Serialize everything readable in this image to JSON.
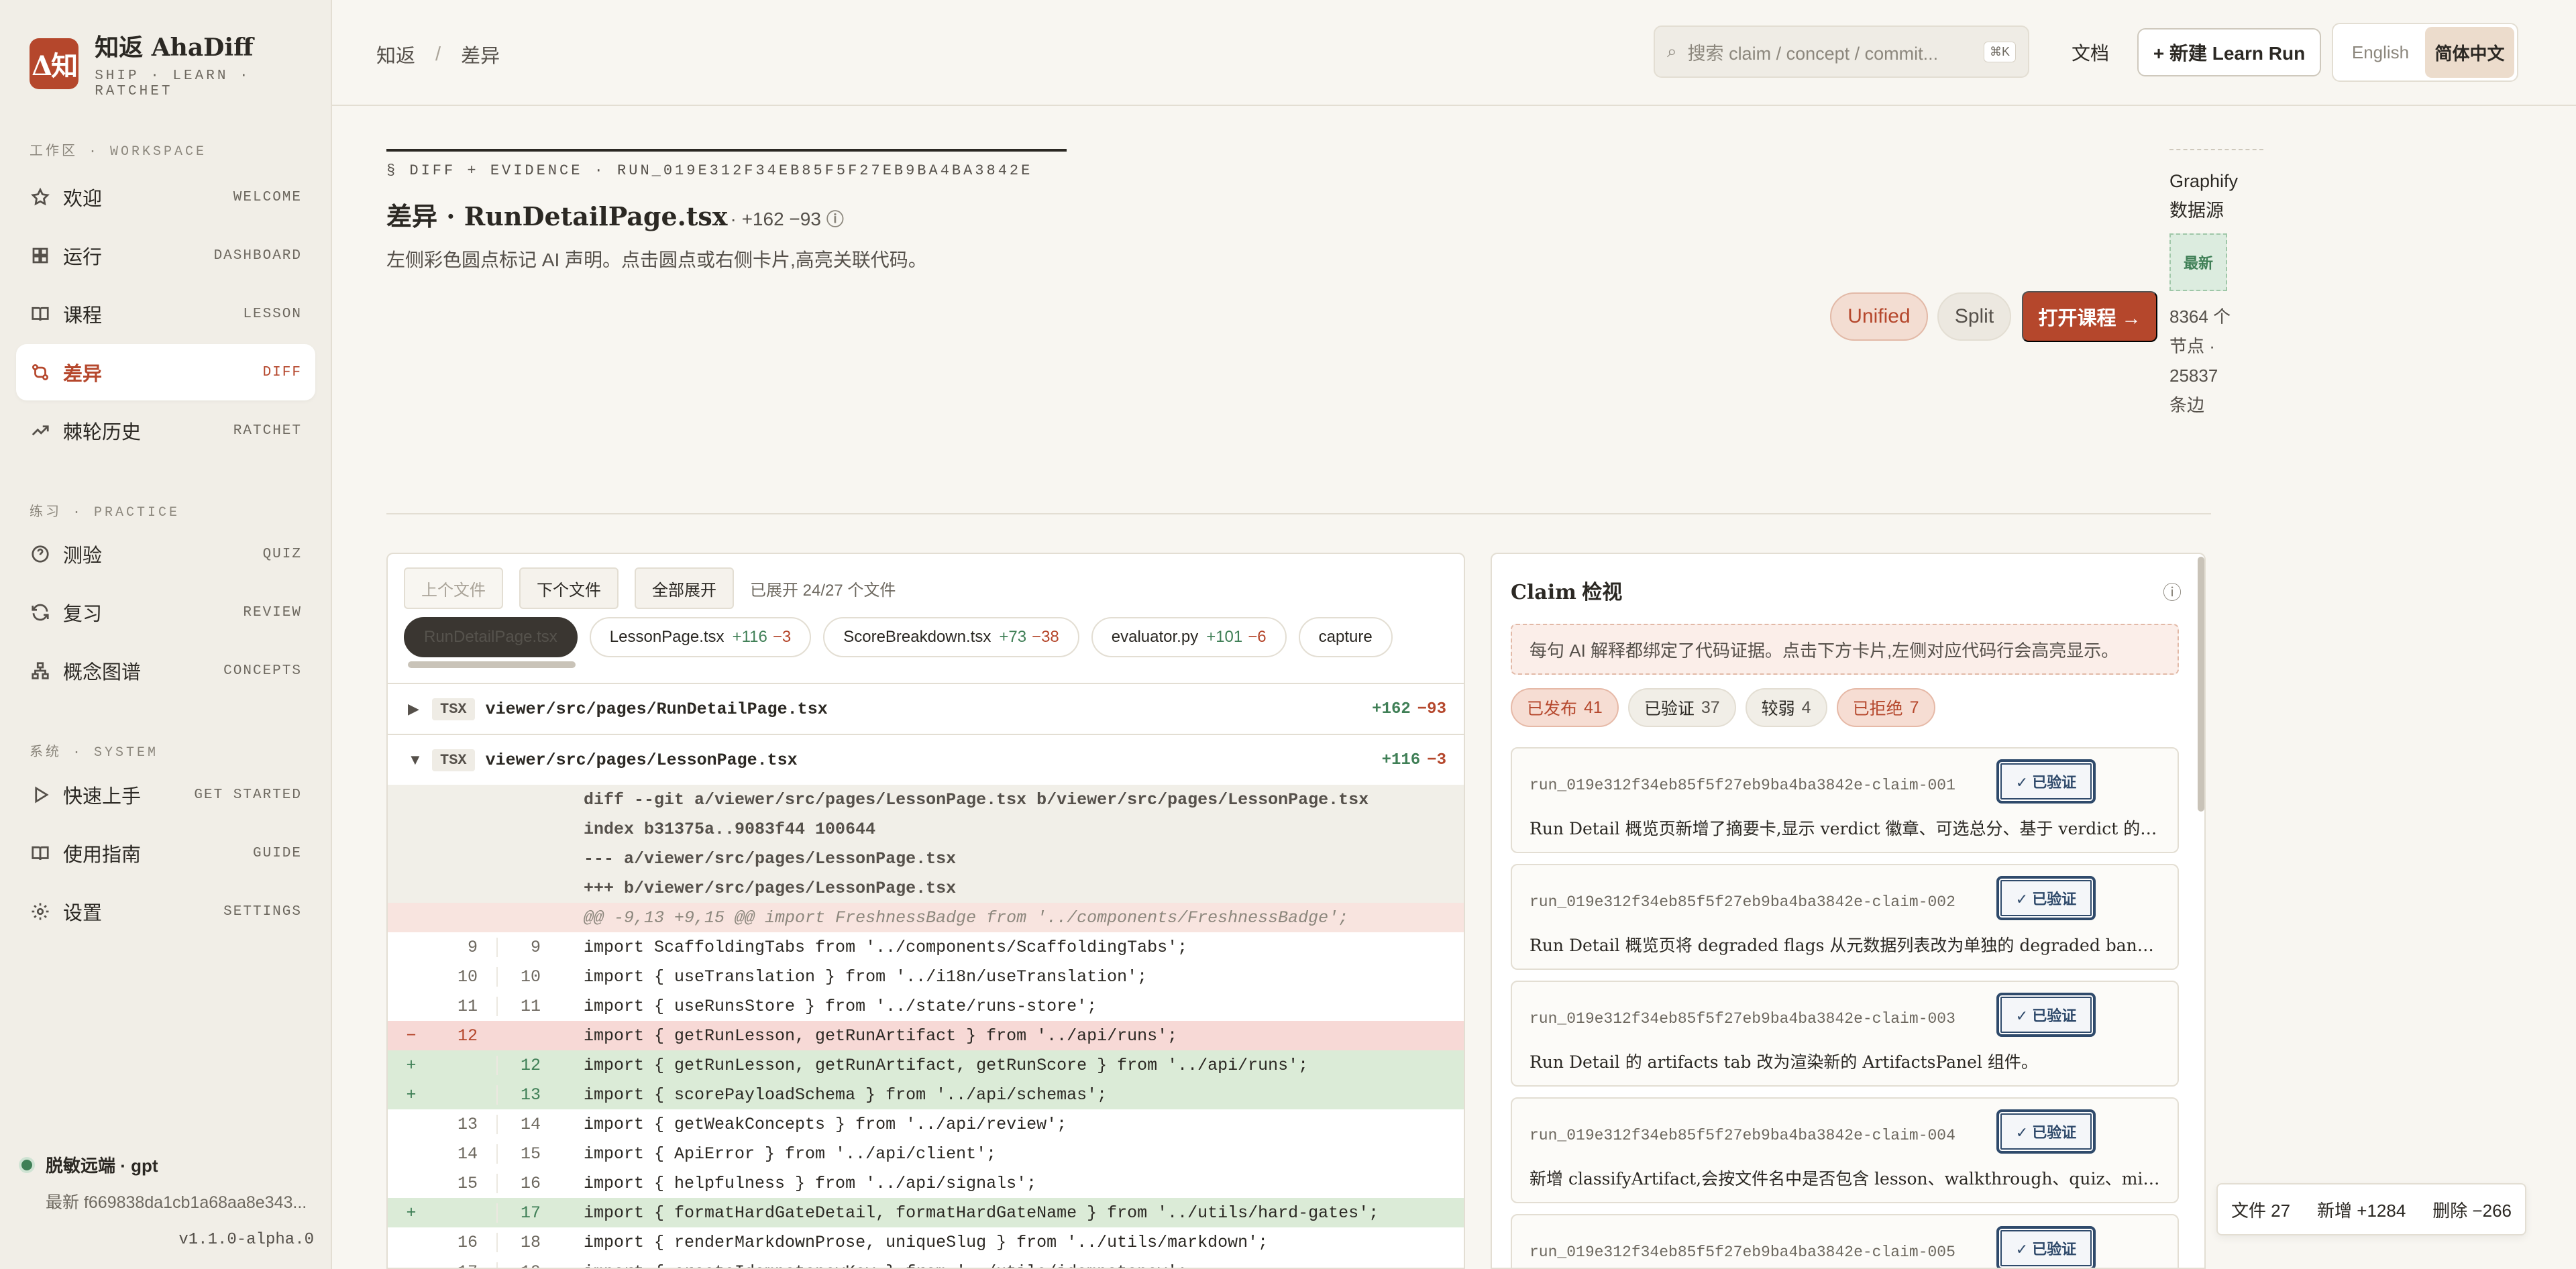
{
  "brand": {
    "logo": "Δ知",
    "title": "知返 AhaDiff",
    "subtitle": "SHIP · LEARN · RATCHET"
  },
  "sidebar": {
    "sections": [
      {
        "label": "工作区 · WORKSPACE"
      },
      {
        "label": "练习 · PRACTICE"
      },
      {
        "label": "系统 · SYSTEM"
      }
    ],
    "items": [
      {
        "label": "欢迎",
        "code": "WELCOME",
        "icon": "star-icon"
      },
      {
        "label": "运行",
        "code": "DASHBOARD",
        "icon": "grid-icon"
      },
      {
        "label": "课程",
        "code": "LESSON",
        "icon": "book-icon"
      },
      {
        "label": "差异",
        "code": "DIFF",
        "icon": "diff-icon",
        "active": true
      },
      {
        "label": "棘轮历史",
        "code": "RATCHET",
        "icon": "trend-icon"
      },
      {
        "label": "测验",
        "code": "QUIZ",
        "icon": "question-icon"
      },
      {
        "label": "复习",
        "code": "REVIEW",
        "icon": "refresh-icon"
      },
      {
        "label": "概念图谱",
        "code": "CONCEPTS",
        "icon": "graph-icon"
      },
      {
        "label": "快速上手",
        "code": "GET STARTED",
        "icon": "play-icon"
      },
      {
        "label": "使用指南",
        "code": "GUIDE",
        "icon": "book-icon"
      },
      {
        "label": "设置",
        "code": "SETTINGS",
        "icon": "gear-icon"
      }
    ],
    "footer": {
      "status": "脱敏远端 · gpt",
      "commit": "最新 f669838da1cb1a68aa8e343...",
      "version": "v1.1.0-alpha.0"
    }
  },
  "topbar": {
    "breadcrumb": [
      "知返",
      "差异"
    ],
    "breadcrumb_sep": "/",
    "search_placeholder": "搜索 claim / concept / commit...",
    "search_kbd": "⌘K",
    "docs_label": "文档",
    "new_run_label": "+ 新建 Learn Run",
    "languages": [
      "English",
      "简体中文"
    ],
    "active_language": "简体中文"
  },
  "header": {
    "eyebrow": "§ DIFF + EVIDENCE · RUN_019E312F34EB85F5F27EB9BA4BA3842E",
    "title": "差异 · RunDetailPage.tsx",
    "stats": "· +162 −93",
    "description": "左侧彩色圆点标记 AI 声明。点击圆点或右侧卡片,高亮关联代码。",
    "view_unified": "Unified",
    "view_split": "Split",
    "open_course": "打开课程 →"
  },
  "graphify": {
    "title_line1": "Graphify",
    "title_line2": "数据源",
    "badge": "最新",
    "stats_lines": [
      "8364 个",
      "节点 ·",
      "25837",
      "条边"
    ]
  },
  "diff": {
    "prev_file": "上个文件",
    "next_file": "下个文件",
    "expand_all": "全部展开",
    "expanded_info": "已展开 24/27 个文件",
    "tabs": [
      {
        "name": "RunDetailPage.tsx",
        "add": "+162",
        "del": "−93",
        "active": true
      },
      {
        "name": "LessonPage.tsx",
        "add": "+116",
        "del": "−3"
      },
      {
        "name": "ScoreBreakdown.tsx",
        "add": "+73",
        "del": "−38"
      },
      {
        "name": "evaluator.py",
        "add": "+101",
        "del": "−6"
      },
      {
        "name": "capture",
        "add": "",
        "del": ""
      }
    ],
    "files": [
      {
        "caret": "▶",
        "lang": "TSX",
        "path": "viewer/src/pages/RunDetailPage.tsx",
        "add": "+162",
        "del": "−93"
      },
      {
        "caret": "▼",
        "lang": "TSX",
        "path": "viewer/src/pages/LessonPage.tsx",
        "add": "+116",
        "del": "−3"
      }
    ],
    "lines": [
      {
        "type": "meta",
        "sign": "",
        "o": "",
        "n": "",
        "text": "diff --git a/viewer/src/pages/LessonPage.tsx b/viewer/src/pages/LessonPage.tsx"
      },
      {
        "type": "meta",
        "sign": "",
        "o": "",
        "n": "",
        "text": "index b31375a..9083f44 100644"
      },
      {
        "type": "meta",
        "sign": "",
        "o": "",
        "n": "",
        "text": "--- a/viewer/src/pages/LessonPage.tsx"
      },
      {
        "type": "meta",
        "sign": "",
        "o": "",
        "n": "",
        "text": "+++ b/viewer/src/pages/LessonPage.tsx"
      },
      {
        "type": "hunk",
        "sign": "",
        "o": "",
        "n": "",
        "text": "@@ -9,13 +9,15 @@ import FreshnessBadge from '../components/FreshnessBadge';"
      },
      {
        "type": "ctx",
        "sign": "",
        "o": "9",
        "n": "9",
        "text": "import ScaffoldingTabs from '../components/ScaffoldingTabs';"
      },
      {
        "type": "ctx",
        "sign": "",
        "o": "10",
        "n": "10",
        "text": "import { useTranslation } from '../i18n/useTranslation';"
      },
      {
        "type": "ctx",
        "sign": "",
        "o": "11",
        "n": "11",
        "text": "import { useRunsStore } from '../state/runs-store';"
      },
      {
        "type": "del",
        "sign": "−",
        "o": "12",
        "n": "",
        "text": "import { getRunLesson, getRunArtifact } from '../api/runs';"
      },
      {
        "type": "add",
        "sign": "+",
        "o": "",
        "n": "12",
        "text": "import { getRunLesson, getRunArtifact, getRunScore } from '../api/runs';"
      },
      {
        "type": "add",
        "sign": "+",
        "o": "",
        "n": "13",
        "text": "import { scorePayloadSchema } from '../api/schemas';"
      },
      {
        "type": "ctx",
        "sign": "",
        "o": "13",
        "n": "14",
        "text": "import { getWeakConcepts } from '../api/review';"
      },
      {
        "type": "ctx",
        "sign": "",
        "o": "14",
        "n": "15",
        "text": "import { ApiError } from '../api/client';"
      },
      {
        "type": "ctx",
        "sign": "",
        "o": "15",
        "n": "16",
        "text": "import { helpfulness } from '../api/signals';"
      },
      {
        "type": "add",
        "sign": "+",
        "o": "",
        "n": "17",
        "text": "import { formatHardGateDetail, formatHardGateName } from '../utils/hard-gates';"
      },
      {
        "type": "ctx",
        "sign": "",
        "o": "16",
        "n": "18",
        "text": "import { renderMarkdownProse, uniqueSlug } from '../utils/markdown';"
      },
      {
        "type": "ctx",
        "sign": "",
        "o": "17",
        "n": "19",
        "text": "import { createIdempotencyKey } from '../utils/idempotency';"
      }
    ]
  },
  "claims": {
    "title_en": "Claim",
    "title_zh": " 检视",
    "notice": "每句 AI 解释都绑定了代码证据。点击下方卡片,左侧对应代码行会高亮显示。",
    "filters": [
      {
        "label": "已发布",
        "count": "41",
        "style": "pub"
      },
      {
        "label": "已验证",
        "count": "37",
        "style": "ver"
      },
      {
        "label": "较弱",
        "count": "4",
        "style": "weak"
      },
      {
        "label": "已拒绝",
        "count": "7",
        "style": "rej"
      }
    ],
    "cards": [
      {
        "id": "run_019e312f34eb85f5f27eb9ba4ba3842e-claim-001",
        "stamp": "✓ 已验证",
        "text": "Run Detail 概览页新增了摘要卡,显示 verdict 徽章、可选总分、基于 verdict 的摘要..."
      },
      {
        "id": "run_019e312f34eb85f5f27eb9ba4ba3842e-claim-002",
        "stamp": "✓ 已验证",
        "text": "Run Detail 概览页将 degraded flags 从元数据列表改为单独的 degraded banner 标..."
      },
      {
        "id": "run_019e312f34eb85f5f27eb9ba4ba3842e-claim-003",
        "stamp": "✓ 已验证",
        "text": "Run Detail 的 artifacts tab 改为渲染新的 ArtifactsPanel 组件。"
      },
      {
        "id": "run_019e312f34eb85f5f27eb9ba4ba3842e-claim-004",
        "stamp": "✓ 已验证",
        "text": "新增 classifyArtifact,会按文件名中是否包含 lesson、walkthrough、quiz、misconce..."
      },
      {
        "id": "run_019e312f34eb85f5f27eb9ba4ba3842e-claim-005",
        "stamp": "✓ 已验证",
        "text": ""
      }
    ]
  },
  "summary": {
    "files": "文件 27",
    "added": "新增 +1284",
    "deleted": "删除 −266"
  }
}
